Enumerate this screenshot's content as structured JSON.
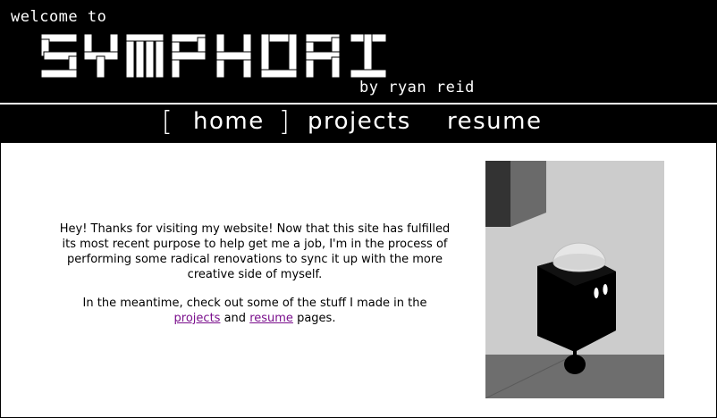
{
  "header": {
    "welcome": "welcome to",
    "logo_text": "SYMPHORI",
    "byline": "by ryan reid"
  },
  "nav": {
    "bracket_open": "[",
    "bracket_close": "]",
    "items": [
      {
        "label": "home",
        "active": true
      },
      {
        "label": "projects",
        "active": false
      },
      {
        "label": "resume",
        "active": false
      }
    ]
  },
  "main": {
    "paragraph1": "Hey! Thanks for visiting my website! Now that this site has fulfilled its most recent purpose to help get me a job, I'm in the process of performing some radical renovations to sync it up with the more creative side of myself.",
    "paragraph2_before": "In the meantime, check out some of the stuff I made in the",
    "link_projects": "projects",
    "paragraph2_middle": "and",
    "link_resume": "resume",
    "paragraph2_after": "pages."
  },
  "colors": {
    "background": "#000000",
    "content_bg": "#ffffff",
    "link_visited": "#7a0f8c"
  }
}
